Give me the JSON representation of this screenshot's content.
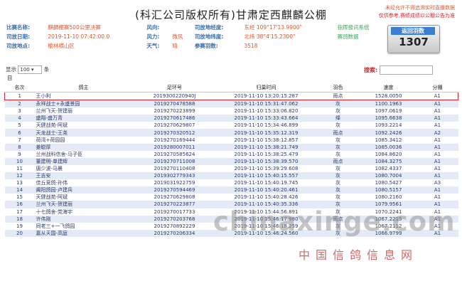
{
  "title": "(科汇公司版权所有)甘肃定西麒麟公棚",
  "notice": {
    "line1": "未经允许不得追溯实时直播数据",
    "line2": "仅供参考,赛绩成绩以公棚公告为准"
  },
  "info": {
    "race_label": "比赛名称:",
    "race_value": "麒麟棚赛500公里决赛",
    "release_time_label": "司放日期:",
    "release_time_value": "2019-11-10 07:42:00.0",
    "release_place_label": "司放地点:",
    "release_place_value": "榆林横山区",
    "wind_dir_label": "风向:",
    "wind_dir_value": "",
    "wind_force_label": "风力:",
    "wind_force_value": "微风",
    "weather_label": "天气:",
    "weather_value": "晴",
    "lon_label": "司放地经度:",
    "lon_value": "东经 109°17'13.9900\"",
    "lat_label": "司放地纬度:",
    "lat_value": "北纬 38°4'15.2300\"",
    "count_label": "参赛羽数:",
    "count_value": "3518",
    "link1": "指挥报讯系统",
    "link2": "赛鸽数据"
  },
  "badge": {
    "header": "返回羽数",
    "value": "1307"
  },
  "controls": {
    "show_label": "显示",
    "page_size": "100",
    "unit_label": "条",
    "order_label": "目"
  },
  "search": {
    "label": "搜索:",
    "value": ""
  },
  "table": {
    "headers": [
      "名次",
      "鸽主",
      "足环号",
      "归巢时间",
      "羽色",
      "速度",
      "分棚"
    ],
    "rows": [
      [
        "1",
        "王小利",
        "2019300220940J",
        "2019-11-10 13:20:15.287",
        "雨点",
        "1528.0050",
        "A1"
      ],
      [
        "2",
        "永祥战士+永盛景园",
        "2019270478588",
        "2019-11-10 15:31:47.062",
        "灰",
        "1100.1963",
        "A1"
      ],
      [
        "3",
        "兰州飞天-贺建丽",
        "2019270223899",
        "2019-11-10 15:33:06.820",
        "灰",
        "1097.0619",
        "A1"
      ],
      [
        "4",
        "盛翔-盛万青",
        "2019270617486",
        "2019-11-10 15:33:43.664",
        "绛",
        "1095.6638",
        "A1"
      ],
      [
        "5",
        "天健战苑-阿斌",
        "2019270629807",
        "2019-11-10 15:34:46.899",
        "灰",
        "1093.2214",
        "A1"
      ],
      [
        "6",
        "天龙战士-王尧",
        "2019270320512",
        "2019-11-10 15:35:12.319",
        "雨点",
        "1092.2426",
        "A2"
      ],
      [
        "7",
        "荷湾+荷园园",
        "2019270169444",
        "2019-11-10 15:38:12.857",
        "灰",
        "1085.3412",
        "A1"
      ],
      [
        "8",
        "姜聪厚",
        "2019280007011",
        "2019-11-10 15:38:21.749",
        "灰",
        "1085.0036",
        "A1"
      ],
      [
        "9",
        "兰州战科信舍-马子臣",
        "2019270585624",
        "2019-11-10 15:38:25.479",
        "灰",
        "1084.8620",
        "A1"
      ],
      [
        "10",
        "董建明-单建辉",
        "2019270711008",
        "2019-11-10 15:38:39.570",
        "雨点",
        "1084.3275",
        "A1"
      ],
      [
        "11",
        "唐少波-马晨",
        "2019270110408",
        "2019-11-10 15:39:29.608",
        "灰",
        "1082.4337",
        "A1"
      ],
      [
        "12",
        "王吉安",
        "2019302779343",
        "2019-11-10 15:40:15.557",
        "灰",
        "1080.7004",
        "A1"
      ],
      [
        "13",
        "佳丘竞鸽-孙伟",
        "2019031922759",
        "2019-11-10 15:40:19.745",
        "灰",
        "1080.5427",
        "A3"
      ],
      [
        "14",
        "阖阳鸽园-卢建兵",
        "2019270594469",
        "2019-11-10 15:40:20.461",
        "灰",
        "1080.5157",
        "A1"
      ],
      [
        "15",
        "天健战苑-阿斌",
        "2019270629808",
        "2019-11-10 15:40:28.426",
        "灰",
        "1080.2160",
        "A1"
      ],
      [
        "16",
        "兰州飞天-贺建丽",
        "2019270223877",
        "2019-11-10 15:40:35.336",
        "灰",
        "1079.9561",
        "A1"
      ],
      [
        "17",
        "十七鸽舍-党海宇",
        "2019270017733",
        "2019-11-10 15:44:56.891",
        "灰",
        "1070.2241",
        "A1"
      ],
      [
        "18",
        "许伟刚",
        "2019270203768",
        "2019-11-10 15:46:17.980",
        "雨点",
        "1067.2215",
        "A1"
      ],
      [
        "19",
        "同老三+一飞鸽园",
        "2019270892229",
        "2019-11-10 15:46:18.259",
        "灰",
        "1067.2112",
        "A1"
      ],
      [
        "20",
        "嘉从天国-高庭",
        "2019270206334",
        "2019-11-10 15:46:24.560",
        "灰",
        "1066.9799",
        "A1"
      ]
    ]
  },
  "watermark": {
    "latin": "chinaxinge.com",
    "cn": "中国信鸽信息网"
  }
}
